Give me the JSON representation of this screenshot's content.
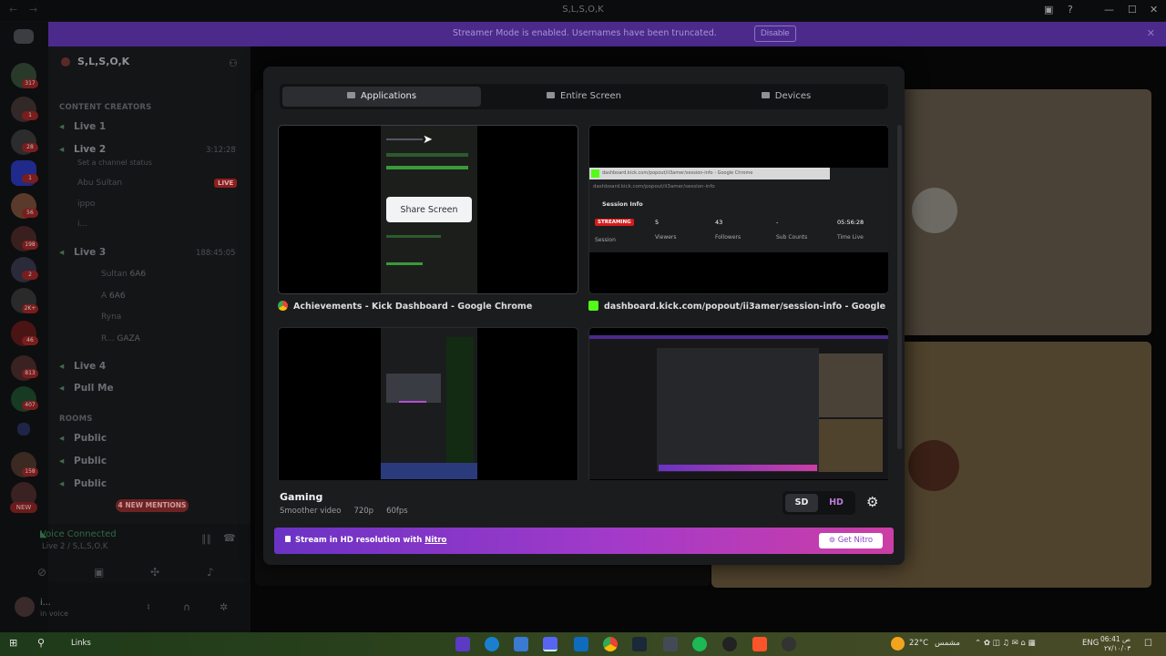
{
  "titlebar": {
    "title": "S,L,S,O,K"
  },
  "banner": {
    "message": "Streamer Mode is enabled. Usernames have been truncated.",
    "disable_label": "Disable"
  },
  "rail": {
    "badges": [
      "317",
      "1",
      "28",
      "1",
      "56",
      "198",
      "2",
      "2K+",
      "46",
      "813",
      "407",
      "158",
      "1"
    ],
    "new_label": "NEW"
  },
  "server": {
    "name": "S,L,S,O,K"
  },
  "channels": {
    "category_creators": "CONTENT CREATORS",
    "live1": "Live 1",
    "live2": "Live 2",
    "live2_time": "3:12:28",
    "live2_status": "Set a channel status",
    "member1": "Abu Sultan",
    "live_badge": "LIVE",
    "member2": "ippo",
    "member3": "i...",
    "live3": "Live 3",
    "live3_time": "188:45:05",
    "member4": "Sultan",
    "member4_tag": "6A6",
    "member5": "A",
    "member5_tag": "6A6",
    "member6": "Ryna",
    "member7": "R...",
    "member7_tag": "GAZA",
    "live4": "Live 4",
    "pullme": "Pull Me",
    "category_rooms": "ROOMS",
    "public1": "Public",
    "public2": "Public",
    "public3": "Public",
    "mentions": "4 NEW MENTIONS"
  },
  "voice": {
    "connected": "Voice Connected",
    "channel": "Live 2 / S,L,S,O,K"
  },
  "user": {
    "name": "i...",
    "status": "in voice"
  },
  "modal": {
    "tabs": [
      {
        "label": "Applications",
        "active": true
      },
      {
        "label": "Entire Screen",
        "active": false
      },
      {
        "label": "Devices",
        "active": false
      }
    ],
    "sources": [
      {
        "label": "Achievements - Kick Dashboard - Google Chrome",
        "share_label": "Share Screen"
      },
      {
        "label": "dashboard.kick.com/popout/ii3amer/session-info - Google Chrome"
      },
      {
        "label": ""
      },
      {
        "label": ""
      }
    ],
    "session": {
      "url": "dashboard.kick.com/popout/ii3amer/session-info - Google Chrome",
      "url2": "dashboard.kick.com/popout/ii3amer/session-info",
      "title": "Session Info",
      "streaming": "STREAMING",
      "session": "Session",
      "viewers_value": "5",
      "viewers_label": "Viewers",
      "followers_value": "43",
      "followers_label": "Followers",
      "subs_value": "-",
      "subs_label": "Sub Counts",
      "time_value": "05:56:28",
      "time_label": "Time Live"
    },
    "quality": {
      "name": "Gaming",
      "desc": "Smoother video",
      "res": "720p",
      "fps": "60fps"
    },
    "resolution": {
      "sd": "SD",
      "hd": "HD",
      "selected": "SD"
    },
    "nitro": {
      "text": "Stream in HD resolution with",
      "link": "Nitro",
      "button": "Get Nitro"
    }
  },
  "taskbar": {
    "links": "Links",
    "weather": "22°C",
    "weather_desc": "مشمس",
    "lang": "ENG",
    "time": "06:41 ص",
    "date": "٢٧/١٠/٠٣"
  },
  "colors": {
    "accent": "#5865f2",
    "streamer_banner": "#4b2a8c",
    "nitro_start": "#6a33c4",
    "nitro_end": "#cc3ea5",
    "live": "#8a2020"
  }
}
